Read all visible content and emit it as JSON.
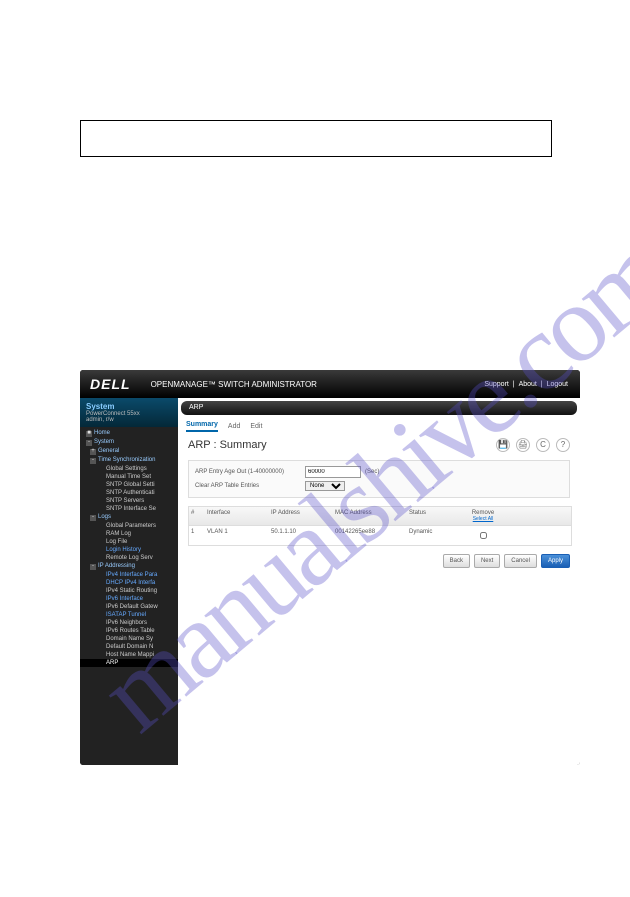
{
  "watermark": "manualshive.com",
  "header": {
    "logo": "DELL",
    "title": "OPENMANAGE™ SWITCH ADMINISTRATOR",
    "links": {
      "support": "Support",
      "about": "About",
      "logout": "Logout"
    }
  },
  "sidebar": {
    "system": "System",
    "product": "PowerConnect 55xx",
    "user": "admin, r/w",
    "items": [
      "Home",
      "System",
      "General",
      "Time Synchronization",
      "Global Settings",
      "Manual Time Set",
      "SNTP Global Setti",
      "SNTP Authenticati",
      "SNTP Servers",
      "SNTP Interface Se",
      "Logs",
      "Global Parameters",
      "RAM Log",
      "Log File",
      "Login History",
      "Remote Log Serv",
      "IP Addressing",
      "IPv4 Interface Para",
      "DHCP IPv4 Interfa",
      "IPv4 Static Routing",
      "IPv6 Interface",
      "IPv6 Default Gatew",
      "ISATAP Tunnel",
      "IPv6 Neighbors",
      "IPv6 Routes Table",
      "Domain Name Sy",
      "Default Domain N",
      "Host Name Mappi",
      "ARP"
    ]
  },
  "breadcrumb": "ARP",
  "tabs": {
    "summary": "Summary",
    "add": "Add",
    "edit": "Edit"
  },
  "title": "ARP : Summary",
  "icons": {
    "save": "💾",
    "print": "🖨",
    "refresh": "C",
    "help": "?"
  },
  "form": {
    "ageout_label": "ARP Entry Age Out  (1-40000000)",
    "ageout_value": "60000",
    "ageout_unit": "(Sec)",
    "clear_label": "Clear ARP Table Entries",
    "clear_value": "None"
  },
  "table": {
    "headers": {
      "num": "#",
      "iface": "Interface",
      "ip": "IP Address",
      "mac": "MAC Address",
      "status": "Status",
      "remove": "Remove",
      "select_all": "Select All"
    },
    "rows": [
      {
        "num": "1",
        "iface": "VLAN 1",
        "ip": "50.1.1.10",
        "mac": "00142265ee88",
        "status": "Dynamic"
      }
    ]
  },
  "buttons": {
    "back": "Back",
    "next": "Next",
    "cancel": "Cancel",
    "apply": "Apply"
  }
}
